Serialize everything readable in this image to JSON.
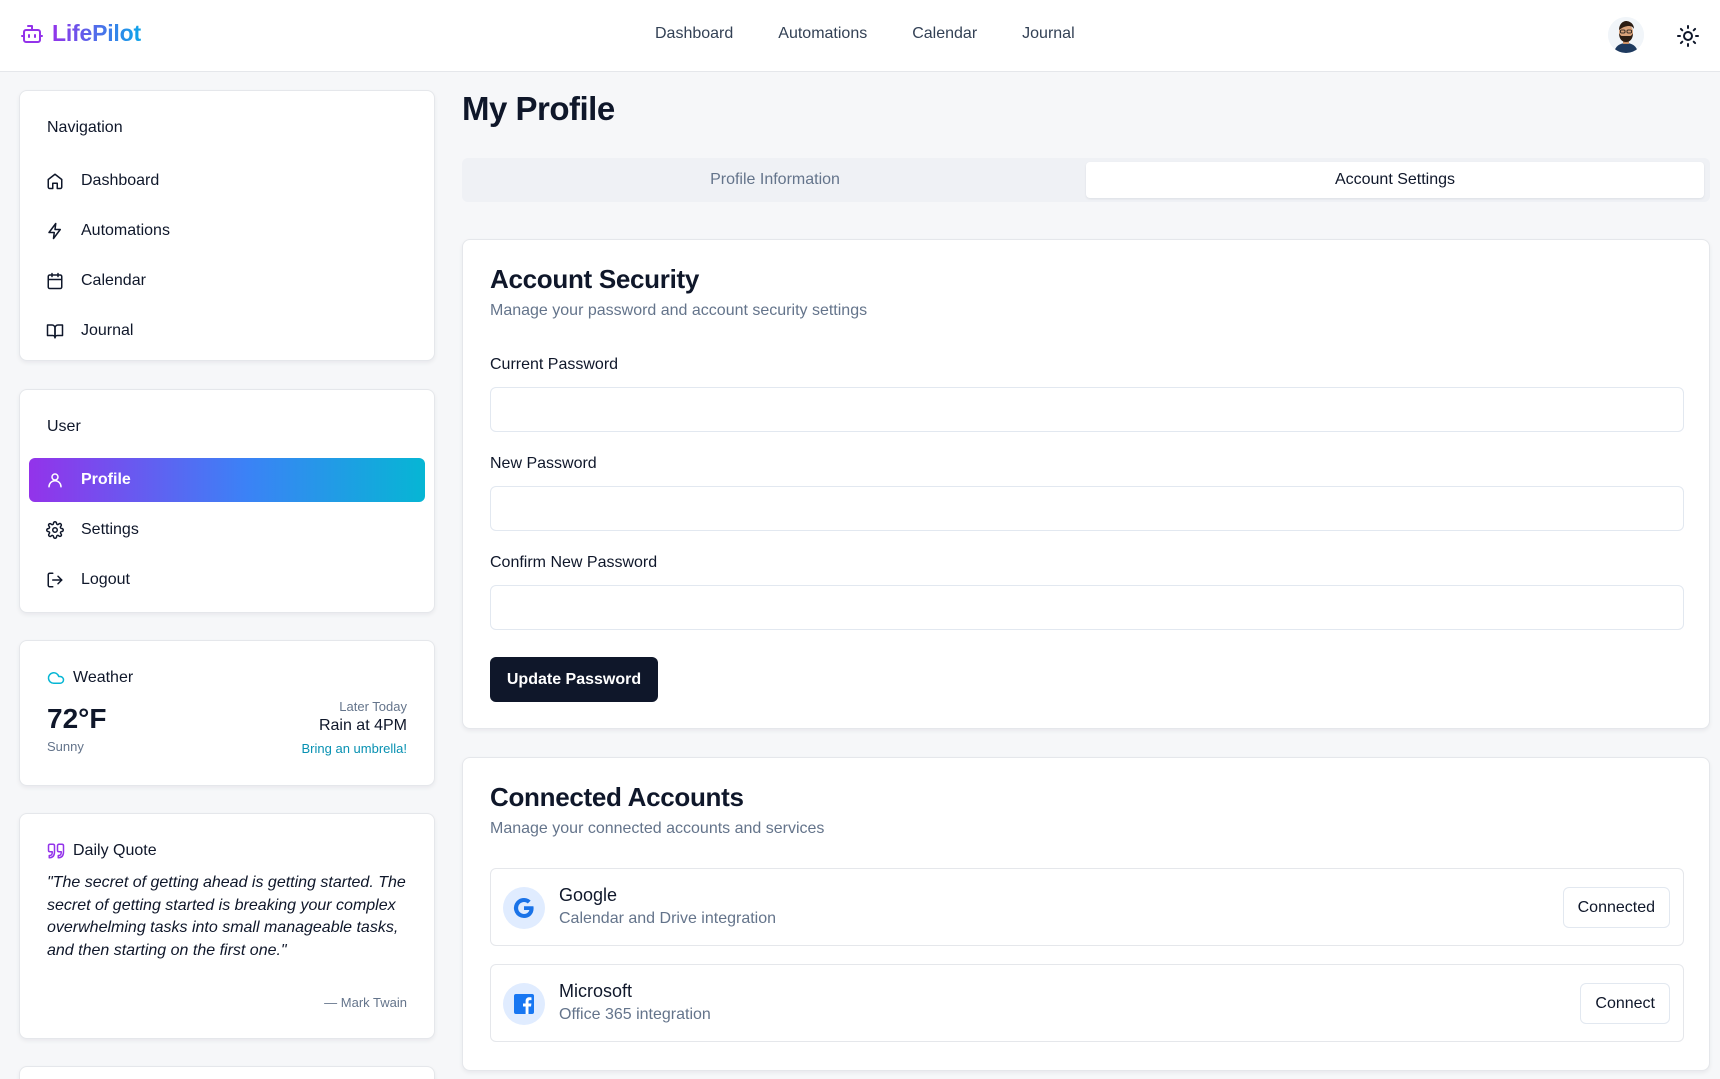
{
  "app": {
    "brand": "LifePilot"
  },
  "topnav": {
    "items": [
      "Dashboard",
      "Automations",
      "Calendar",
      "Journal"
    ]
  },
  "sidebar": {
    "navigation_title": "Navigation",
    "nav_items": [
      {
        "label": "Dashboard",
        "icon": "home-icon"
      },
      {
        "label": "Automations",
        "icon": "lightning-icon"
      },
      {
        "label": "Calendar",
        "icon": "calendar-icon"
      },
      {
        "label": "Journal",
        "icon": "book-icon"
      }
    ],
    "user_title": "User",
    "user_items": [
      {
        "label": "Profile",
        "icon": "user-icon",
        "active": true
      },
      {
        "label": "Settings",
        "icon": "gear-icon"
      },
      {
        "label": "Logout",
        "icon": "logout-icon"
      }
    ]
  },
  "weather": {
    "title": "Weather",
    "temperature": "72°F",
    "condition": "Sunny",
    "later_label": "Later Today",
    "forecast": "Rain at 4PM",
    "tip": "Bring an umbrella!"
  },
  "quote": {
    "title": "Daily Quote",
    "text": "\"The secret of getting ahead is getting started. The secret of getting started is breaking your complex overwhelming tasks into small manageable tasks, and then starting on the first one.\"",
    "author": "— Mark Twain"
  },
  "main": {
    "page_title": "My Profile",
    "tabs": [
      {
        "label": "Profile Information",
        "active": false
      },
      {
        "label": "Account Settings",
        "active": true
      }
    ],
    "security": {
      "title": "Account Security",
      "subtitle": "Manage your password and account security settings",
      "fields": [
        {
          "label": "Current Password",
          "value": ""
        },
        {
          "label": "New Password",
          "value": ""
        },
        {
          "label": "Confirm New Password",
          "value": ""
        }
      ],
      "button": "Update Password"
    },
    "connected": {
      "title": "Connected Accounts",
      "subtitle": "Manage your connected accounts and services",
      "accounts": [
        {
          "name": "Google",
          "description": "Calendar and Drive integration",
          "action": "Connected",
          "icon": "google-icon"
        },
        {
          "name": "Microsoft",
          "description": "Office 365 integration",
          "action": "Connect",
          "icon": "facebook-icon"
        }
      ]
    }
  },
  "colors": {
    "accent_start": "#9333ea",
    "accent_end": "#06b6d4",
    "primary_button": "#0f172a",
    "link": "#0891b2"
  }
}
